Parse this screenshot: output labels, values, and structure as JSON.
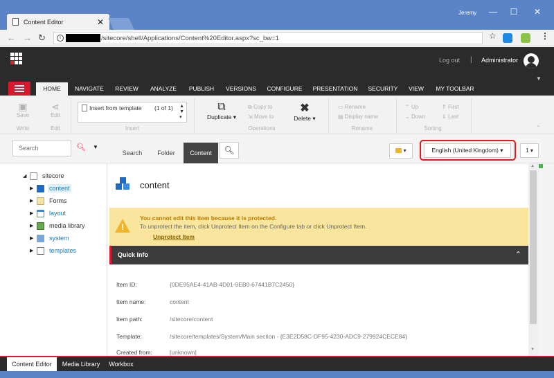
{
  "browser": {
    "tab_title": "Content Editor",
    "tab_close": "✕",
    "user": "Jeremy",
    "url": "/sitecore/shell/Applications/Content%20Editor.aspx?sc_bw=1",
    "win_min": "—",
    "win_max": "☐",
    "win_close": "✕"
  },
  "header": {
    "logout": "Log out",
    "separator": "|",
    "user": "Administrator"
  },
  "ribbon_tabs": [
    "HOME",
    "NAVIGATE",
    "REVIEW",
    "ANALYZE",
    "PUBLISH",
    "VERSIONS",
    "CONFIGURE",
    "PRESENTATION",
    "SECURITY",
    "VIEW",
    "MY TOOLBAR"
  ],
  "ribbon": {
    "save": "Save",
    "edit": "Edit",
    "write_group": "Write",
    "edit_group": "Edit",
    "insert_from_template": "Insert from template",
    "insert_count": "(1 of 1)",
    "insert_group": "Insert",
    "duplicate": "Duplicate ▾",
    "copy_to": "Copy to",
    "move_to": "Move to",
    "delete": "Delete ▾",
    "operations_group": "Operations",
    "rename": "Rename",
    "display_name": "Display name",
    "rename_group": "Rename",
    "up": "Up",
    "down": "Down",
    "first": "First",
    "last": "Last",
    "sorting_group": "Sorting"
  },
  "search": {
    "placeholder": "Search"
  },
  "tree": {
    "root": "sitecore",
    "items": [
      "content",
      "Forms",
      "layout",
      "media library",
      "system",
      "templates"
    ]
  },
  "main_tabs": [
    "Search",
    "Folder",
    "Content"
  ],
  "language": "English (United Kingdom) ▾",
  "version": "1 ▾",
  "item": {
    "title": "content"
  },
  "warning": {
    "title": "You cannot edit this item because it is protected.",
    "text": "To unprotect the item, click Unprotect Item on the Configure tab or click Unprotect Item.",
    "link": "Unprotect Item"
  },
  "quick_info": {
    "title": "Quick Info",
    "rows": [
      {
        "label": "Item ID:",
        "value": "{0DE95AE4-41AB-4D01-9EB0-67441B7C2450}"
      },
      {
        "label": "Item name:",
        "value": "content"
      },
      {
        "label": "Item path:",
        "value": "/sitecore/content"
      },
      {
        "label": "Template:",
        "value": "/sitecore/templates/System/Main section - {E3E2D58C-DF95-4230-ADC9-279924CECE84}"
      },
      {
        "label": "Created from:",
        "value": "[unknown]"
      }
    ]
  },
  "bottom_tabs": [
    "Content Editor",
    "Media Library",
    "Workbox"
  ],
  "colors": {
    "accent": "#d8182e",
    "chrome": "#5a84c7",
    "dark": "#2b2b2b",
    "warning_bg": "#f9e59d",
    "highlight": "#e21a1a"
  }
}
